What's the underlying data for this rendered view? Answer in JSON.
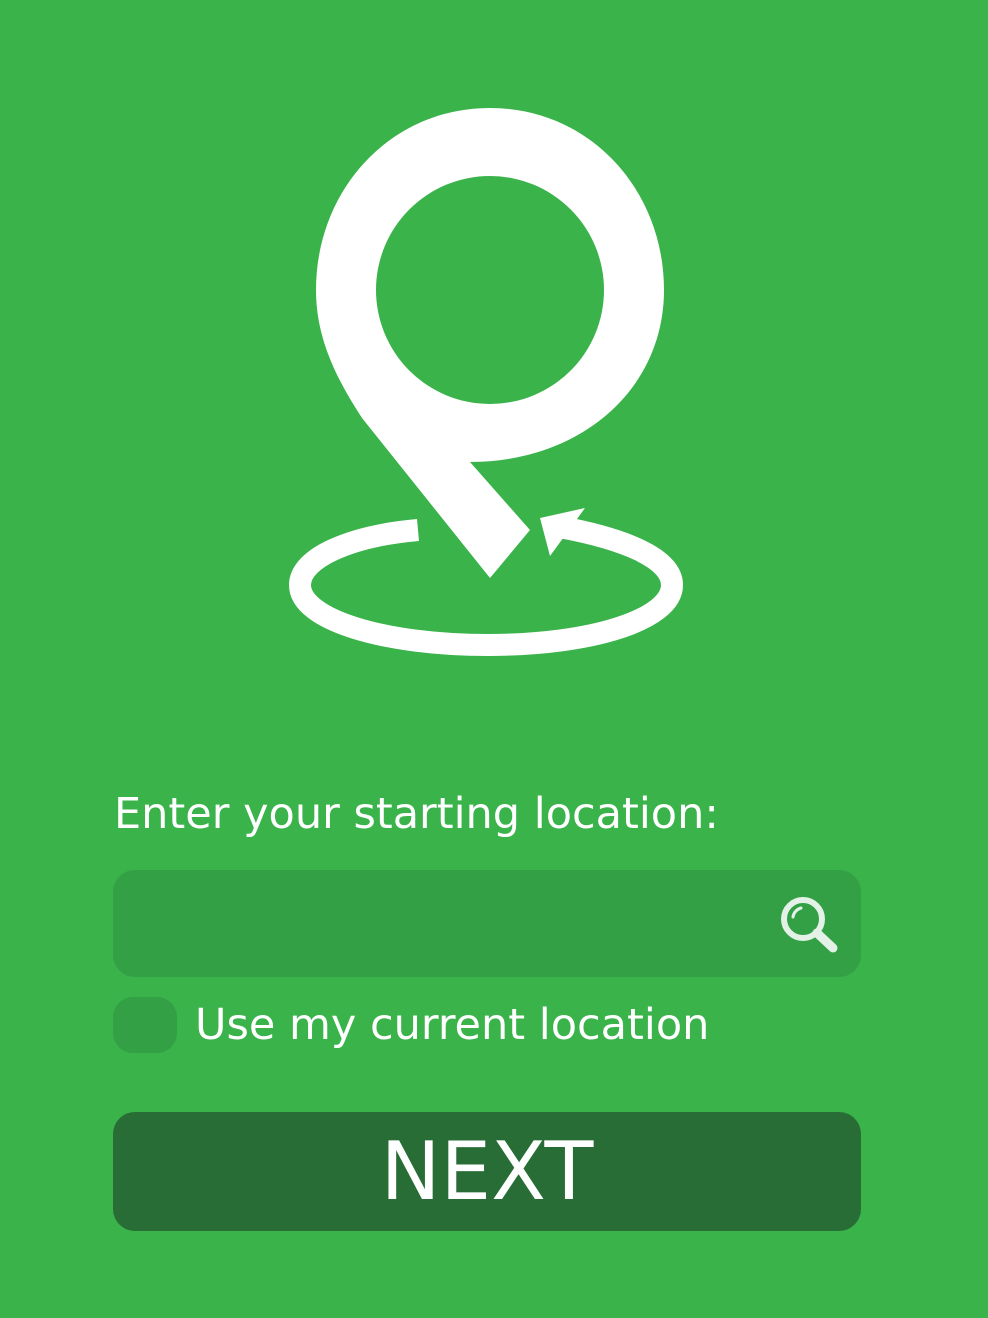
{
  "colors": {
    "background": "#39b34a",
    "input_fill": "#33a046",
    "checkbox_fill": "#33a046",
    "button_fill": "#296d36",
    "foreground": "#ffffff",
    "icon_light": "#e4f1e6"
  },
  "logo": {
    "icon": "map-pin-with-circular-arrow"
  },
  "form": {
    "prompt": "Enter your starting location:",
    "search": {
      "value": "",
      "placeholder": "",
      "icon": "search-icon"
    },
    "current_location": {
      "label": "Use my current location",
      "checked": false
    },
    "next_label": "NEXT"
  }
}
